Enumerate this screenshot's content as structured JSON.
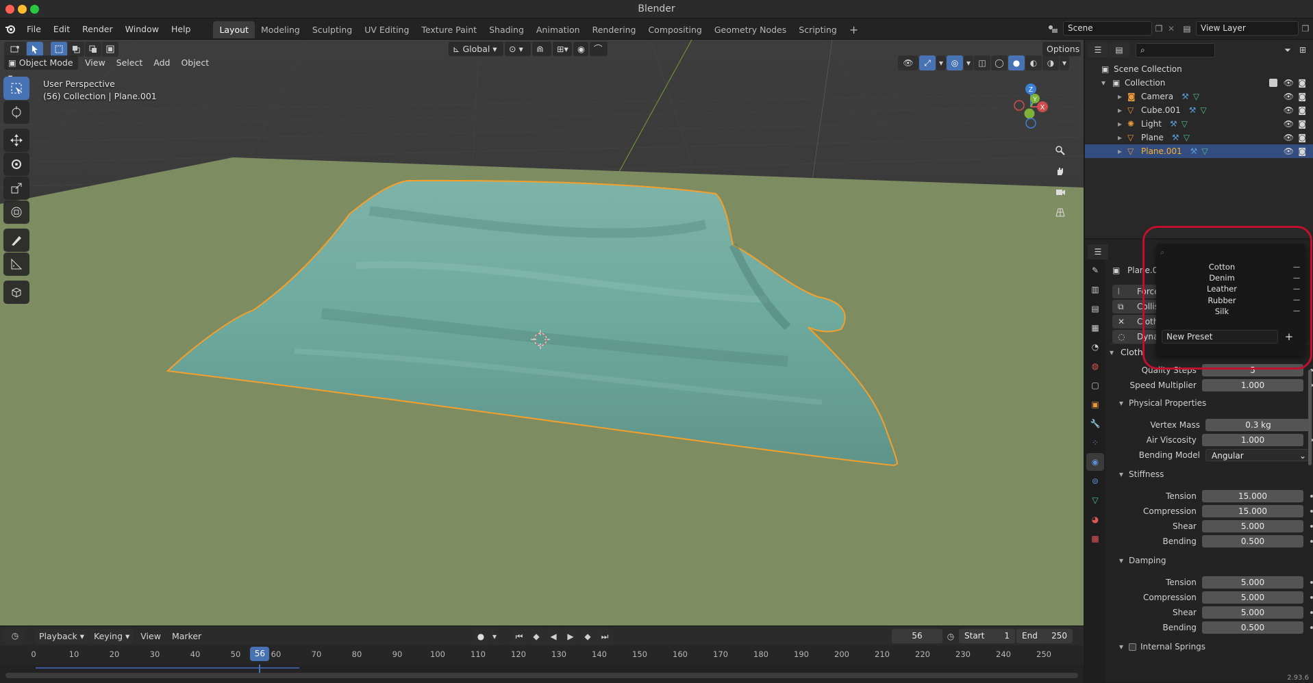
{
  "app": {
    "title": "Blender"
  },
  "menus": [
    "File",
    "Edit",
    "Render",
    "Window",
    "Help"
  ],
  "workspaces": {
    "tabs": [
      "Layout",
      "Modeling",
      "Sculpting",
      "UV Editing",
      "Texture Paint",
      "Shading",
      "Animation",
      "Rendering",
      "Compositing",
      "Geometry Nodes",
      "Scripting"
    ],
    "active": "Layout"
  },
  "scene": {
    "scene_name": "Scene",
    "view_layer": "View Layer"
  },
  "viewport": {
    "mode": "Object Mode",
    "menus": [
      "View",
      "Select",
      "Add",
      "Object"
    ],
    "transform_orientation": "Global",
    "options_label": "Options",
    "info_line1": "User Perspective",
    "info_line2": "(56) Collection | Plane.001",
    "gizmo": {
      "x": "X",
      "y": "Y",
      "z": "Z"
    }
  },
  "timeline": {
    "menus": [
      "Playback",
      "Keying",
      "View",
      "Marker"
    ],
    "current_frame": "56",
    "start_label": "Start",
    "start": "1",
    "end_label": "End",
    "end": "250",
    "ticks": [
      "0",
      "10",
      "20",
      "30",
      "40",
      "50",
      "60",
      "70",
      "80",
      "90",
      "100",
      "110",
      "120",
      "130",
      "140",
      "150",
      "160",
      "170",
      "180",
      "190",
      "200",
      "210",
      "220",
      "230",
      "240",
      "250"
    ],
    "playhead": "56"
  },
  "outliner": {
    "root": "Scene Collection",
    "collection": "Collection",
    "items": [
      {
        "name": "Camera",
        "selected": false
      },
      {
        "name": "Cube.001",
        "selected": false
      },
      {
        "name": "Light",
        "selected": false
      },
      {
        "name": "Plane",
        "selected": false
      },
      {
        "name": "Plane.001",
        "selected": true
      }
    ]
  },
  "properties": {
    "object_name": "Plane.001",
    "modifier_rows": [
      "Force Field",
      "Collision",
      "Cloth",
      "Dynamic Paint"
    ],
    "cloth_panel": "Cloth",
    "quality_steps_label": "Quality Steps",
    "quality_steps": "5",
    "speed_multiplier_label": "Speed Multiplier",
    "speed_multiplier": "1.000",
    "physical": {
      "header": "Physical Properties",
      "vertex_mass_label": "Vertex Mass",
      "vertex_mass": "0.3 kg",
      "air_viscosity_label": "Air Viscosity",
      "air_viscosity": "1.000",
      "bending_model_label": "Bending Model",
      "bending_model": "Angular"
    },
    "stiffness": {
      "header": "Stiffness",
      "tension_label": "Tension",
      "tension": "15.000",
      "compression_label": "Compression",
      "compression": "15.000",
      "shear_label": "Shear",
      "shear": "5.000",
      "bending_label": "Bending",
      "bending": "0.500"
    },
    "damping": {
      "header": "Damping",
      "tension_label": "Tension",
      "tension": "5.000",
      "compression_label": "Compression",
      "compression": "5.000",
      "shear_label": "Shear",
      "shear": "5.000",
      "bending_label": "Bending",
      "bending": "0.500"
    },
    "internal_springs": "Internal Springs",
    "version": "2.93.6"
  },
  "preset_menu": {
    "items": [
      "Cotton",
      "Denim",
      "Leather",
      "Rubber",
      "Silk"
    ],
    "new_preset": "New Preset",
    "remove_symbol": "—",
    "add_symbol": "+"
  },
  "colors": {
    "accent": "#4772b3",
    "selection_orange": "#ffaf29",
    "highlight_ring": "#c0102e",
    "ground": "#7e8c62",
    "cloth": "#5a9a8f"
  }
}
